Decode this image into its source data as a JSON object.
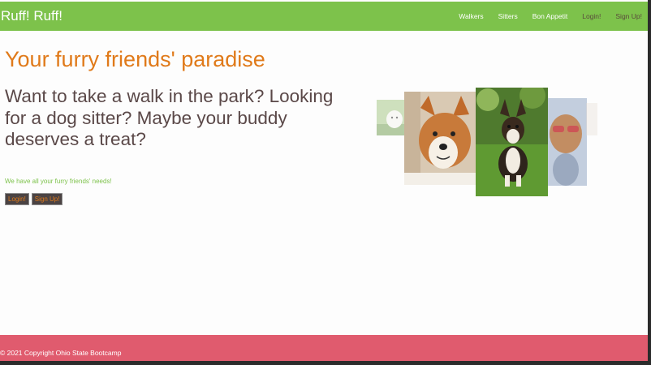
{
  "navbar": {
    "brand": "Ruff! Ruff!",
    "links": [
      "Walkers",
      "Sitters",
      "Bon Appetit",
      "Login!",
      "Sign Up!"
    ]
  },
  "hero": {
    "title": "Your furry friends' paradise",
    "subtitle": "Want to take a walk in the park? Looking for a dog sitter? Maybe your buddy deserves a treat?",
    "tagline": "We have all your furry friends' needs!",
    "login_label": "Login!",
    "signup_label": "Sign Up!"
  },
  "carousel": {
    "images": [
      "white-dog-photo",
      "corgi-closeup-photo",
      "corgi-on-grass-photo",
      "dog-with-sunglasses-photo",
      "faded-photo"
    ]
  },
  "footer": {
    "text": "© 2021 Copyright Ohio State Bootcamp"
  },
  "colors": {
    "navbar": "#7dc24b",
    "footer": "#e05b6e",
    "accent": "#e07a1a",
    "text": "#5a4848"
  }
}
